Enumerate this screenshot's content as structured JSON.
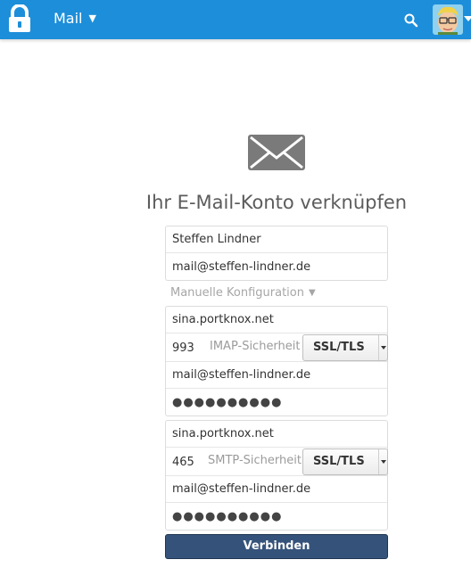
{
  "header": {
    "app_menu_label": "Mail",
    "app_menu_icon": "chevron-down-icon",
    "logo_icon": "padlock-icon",
    "search_icon": "search-icon",
    "avatar_icon": "avatar",
    "brand_color": "#1d8ed9"
  },
  "main": {
    "title": "Ihr E-Mail-Konto verknüpfen",
    "mail_icon": "envelope-icon",
    "name_value": "Steffen Lindner",
    "email_value": "mail@steffen-lindner.de",
    "manual_config_label": "Manuelle Konfiguration",
    "imap": {
      "host": "sina.portknox.net",
      "port": "993",
      "security_label": "IMAP-Sicherheit",
      "security_value": "SSL/TLS",
      "user": "mail@steffen-lindner.de",
      "password_mask": "●●●●●●●●●●"
    },
    "smtp": {
      "host": "sina.portknox.net",
      "port": "465",
      "security_label": "SMTP-Sicherheit",
      "security_value": "SSL/TLS",
      "user": "mail@steffen-lindner.de",
      "password_mask": "●●●●●●●●●●"
    },
    "connect_label": "Verbinden",
    "connect_color": "#35537a"
  }
}
